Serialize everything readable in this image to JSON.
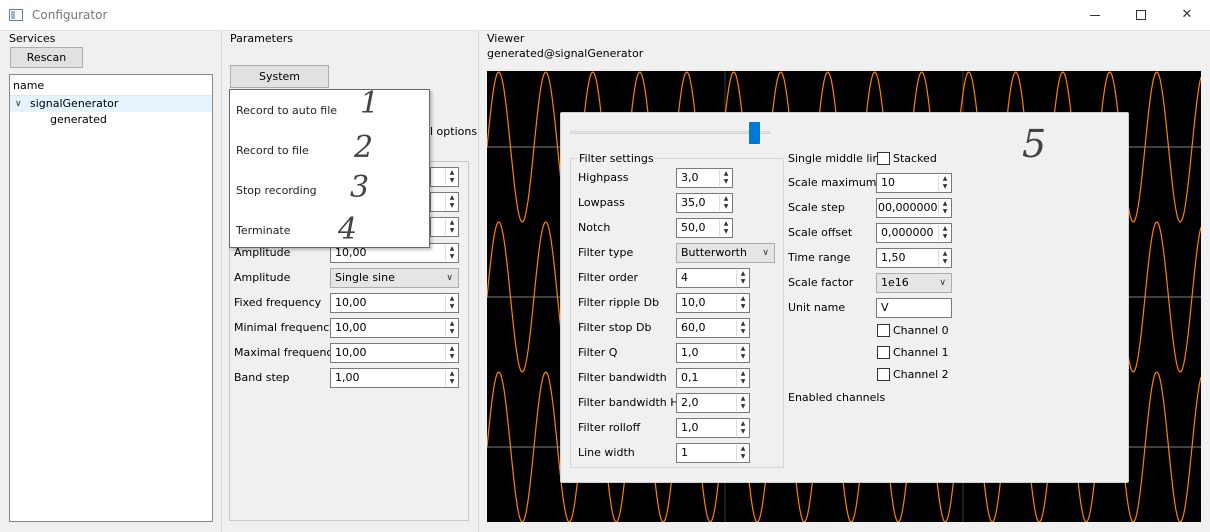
{
  "window": {
    "title": "Configurator"
  },
  "services": {
    "label": "Services",
    "rescan_label": "Rescan",
    "tree_header": "name",
    "items": [
      {
        "label": "signalGenerator"
      },
      {
        "label": "generated"
      }
    ]
  },
  "parameters": {
    "label": "Parameters",
    "system_button": "System",
    "options_partial": "l options",
    "rows": [
      {
        "label": "Amplitude",
        "value": "10,00"
      },
      {
        "label": "Amplitude",
        "value": "Single sine"
      },
      {
        "label": "Fixed frequency",
        "value": "10,00"
      },
      {
        "label": "Minimal frequency",
        "value": "10,00"
      },
      {
        "label": "Maximal frequency",
        "value": "10,00"
      },
      {
        "label": "Band step",
        "value": "1,00"
      }
    ],
    "menu": {
      "items": [
        "Record to auto file",
        "Record to file",
        "Stop recording",
        "Terminate"
      ],
      "annotations": [
        "1",
        "2",
        "3",
        "4"
      ]
    }
  },
  "viewer": {
    "label": "Viewer",
    "source": "generated@signalGenerator",
    "annotation": "5",
    "wave_color": "#ff8000",
    "filter": {
      "group_title": "Filter settings",
      "highpass_label": "Highpass",
      "highpass": "3,0",
      "lowpass_label": "Lowpass",
      "lowpass": "35,0",
      "notch_label": "Notch",
      "notch": "50,0",
      "type_label": "Filter type",
      "type": "Butterworth",
      "order_label": "Filter order",
      "order": "4",
      "ripple_label": "Filter ripple Db",
      "ripple": "10,0",
      "stop_label": "Filter stop Db",
      "stop": "60,0",
      "q_label": "Filter Q",
      "q": "1,0",
      "bandwidth_label": "Filter bandwidth",
      "bandwidth": "0,1",
      "bandwidth_hz_label": "Filter bandwidth Hz",
      "bandwidth_hz": "2,0",
      "rolloff_label": "Filter rolloff",
      "rolloff": "1,0",
      "linewidth_label": "Line width",
      "linewidth": "1"
    },
    "display": {
      "single_middle_line": "Single middle line",
      "stacked": "Stacked",
      "scale_max_label": "Scale maximum",
      "scale_max": "10",
      "scale_step_label": "Scale step",
      "scale_step": "00,000000",
      "scale_offset_label": "Scale offset",
      "scale_offset": "0,000000",
      "time_range_label": "Time range",
      "time_range": "1,50",
      "scale_factor_label": "Scale factor",
      "scale_factor": "1e16",
      "unit_name_label": "Unit name",
      "unit_name": "V",
      "channels": [
        "Channel 0",
        "Channel 1",
        "Channel 2"
      ],
      "enabled_channels": "Enabled channels"
    }
  }
}
